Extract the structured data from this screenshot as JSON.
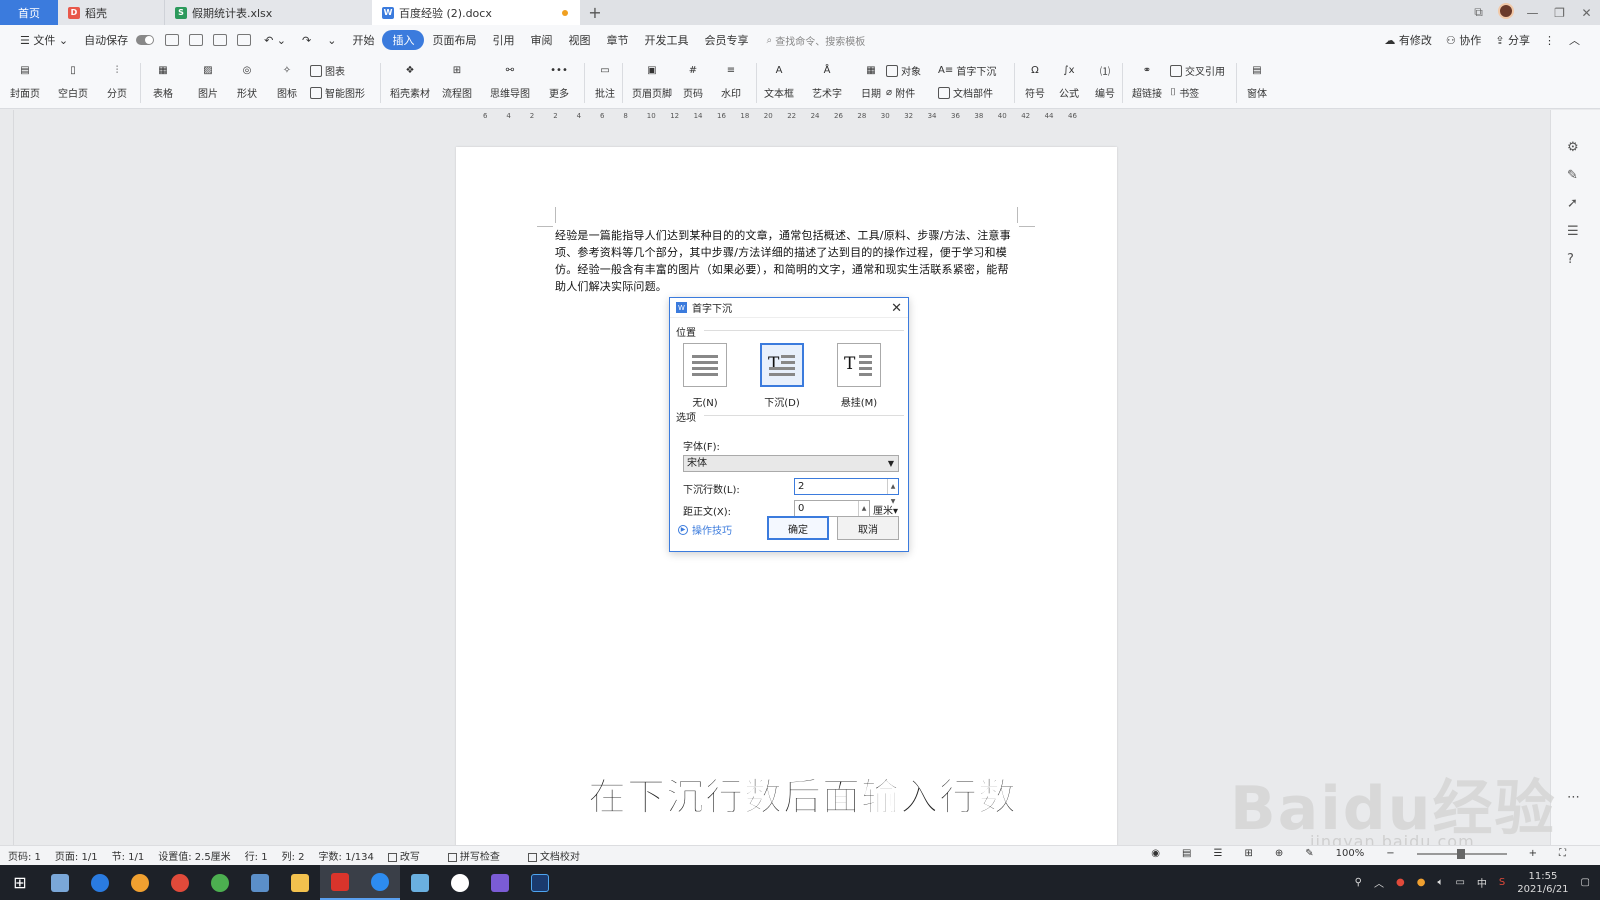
{
  "tabs": {
    "home": "首页",
    "t1": "稻壳",
    "t2": "假期统计表.xlsx",
    "t3": "百度经验 (2).docx"
  },
  "menu": {
    "file": "文件",
    "autosave": "自动保存",
    "items": [
      "开始",
      "插入",
      "页面布局",
      "引用",
      "审阅",
      "视图",
      "章节",
      "开发工具",
      "会员专享"
    ],
    "active_index": 1,
    "search_placeholder": "查找命令、搜索模板",
    "right": [
      "有修改",
      "协作",
      "分享"
    ]
  },
  "ribbon": {
    "cover": "封面页",
    "blank": "空白页",
    "pagebreak": "分页",
    "table": "表格",
    "picture": "图片",
    "shape": "形状",
    "icon": "图标",
    "chart": "图表",
    "smart": "智能图形",
    "daoke": "稻壳素材",
    "flow": "流程图",
    "mind": "思维导图",
    "more": "更多",
    "comment": "批注",
    "header": "页眉页脚",
    "pagenum": "页码",
    "watermark": "水印",
    "textbox": "文本框",
    "wordart": "艺术字",
    "date": "日期",
    "object": "对象",
    "attach": "附件",
    "dropcap": "首字下沉",
    "docpart": "文档部件",
    "symbol": "符号",
    "formula": "公式",
    "numbering": "编号",
    "hyperlink": "超链接",
    "crossref": "交叉引用",
    "bookmark": "书签",
    "window": "窗体"
  },
  "ruler": [
    "6",
    "4",
    "2",
    "2",
    "4",
    "6",
    "8",
    "10",
    "12",
    "14",
    "16",
    "18",
    "20",
    "22",
    "24",
    "26",
    "28",
    "30",
    "32",
    "34",
    "36",
    "38",
    "40",
    "42",
    "44",
    "46"
  ],
  "document": {
    "paragraph": "经验是一篇能指导人们达到某种目的的文章，通常包括概述、工具/原料、步骤/方法、注意事项、参考资料等几个部分，其中步骤/方法详细的描述了达到目的的操作过程，便于学习和模仿。经验一般含有丰富的图片（如果必要），和简明的文字，通常和现实生活联系紧密，能帮助人们解决实际问题。"
  },
  "dialog": {
    "title": "首字下沉",
    "position_label": "位置",
    "options": [
      "无(N)",
      "下沉(D)",
      "悬挂(M)"
    ],
    "selected_option": 1,
    "options_label": "选项",
    "font_label": "字体(F):",
    "font_value": "宋体",
    "lines_label": "下沉行数(L):",
    "lines_value": "2",
    "distance_label": "距正文(X):",
    "distance_value": "0",
    "distance_unit": "厘米",
    "tips": "操作技巧",
    "ok": "确定",
    "cancel": "取消"
  },
  "subtitle": "在下沉行数后面输入行数",
  "watermark": {
    "brand": "Baidu经验",
    "url": "jingyan.baidu.com"
  },
  "status": {
    "page": "页码: 1",
    "pages": "页面: 1/1",
    "section": "节: 1/1",
    "setting": "设置值: 2.5厘米",
    "row": "行: 1",
    "col": "列: 2",
    "words": "字数: 1/134",
    "revise": "改写",
    "spell": "拼写检查",
    "proof": "文档校对",
    "zoom": "100%"
  },
  "clock": {
    "time": "11:55",
    "date": "2021/6/21"
  },
  "tray_lang": "中",
  "colors": {
    "accent": "#3b7bdd",
    "wps_red": "#d9342b"
  }
}
